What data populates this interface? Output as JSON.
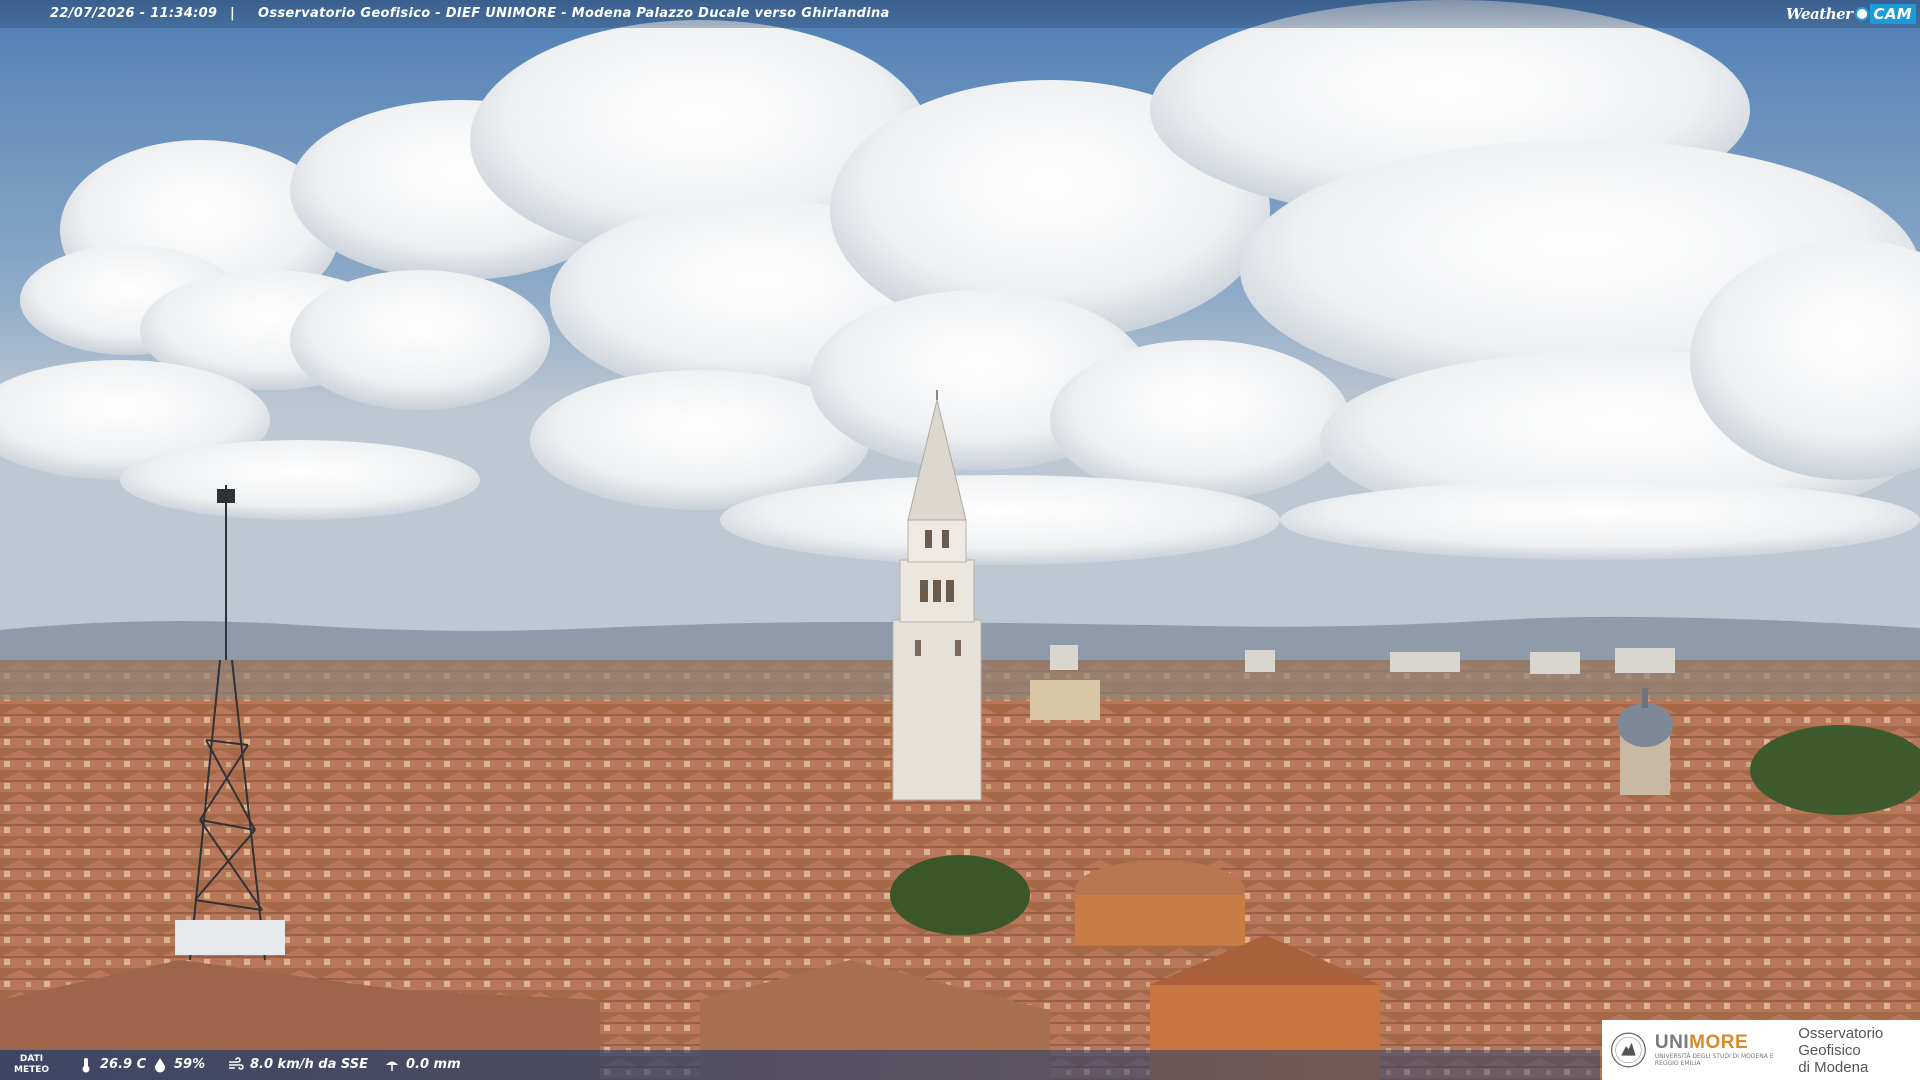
{
  "header": {
    "timestamp": "22/07/2026 - 11:34:09",
    "separator": "|",
    "title": "Osservatorio Geofisico - DIEF UNIMORE - Modena Palazzo Ducale verso Ghirlandina",
    "brand_weather": "Weather",
    "brand_cam": "CAM"
  },
  "weather": {
    "label_line1": "DATI",
    "label_line2": "METEO",
    "temperature": "26.9 C",
    "humidity": "59%",
    "wind": "8.0 km/h da SSE",
    "rain": "0.0 mm"
  },
  "logo": {
    "uni_name_a": "UNI",
    "uni_name_b": "MORE",
    "uni_sub": "UNIVERSITÀ DEGLI STUDI DI MODENA E REGGIO EMILIA",
    "observatory_line1": "Osservatorio Geofisico",
    "observatory_line2": "di Modena"
  },
  "colors": {
    "sky_top": "#5d8bbd",
    "sky_horizon": "#b9c6d3",
    "roof": "#a86a48",
    "tower": "#e8e4dc",
    "cam_accent": "#1e9bd7"
  }
}
